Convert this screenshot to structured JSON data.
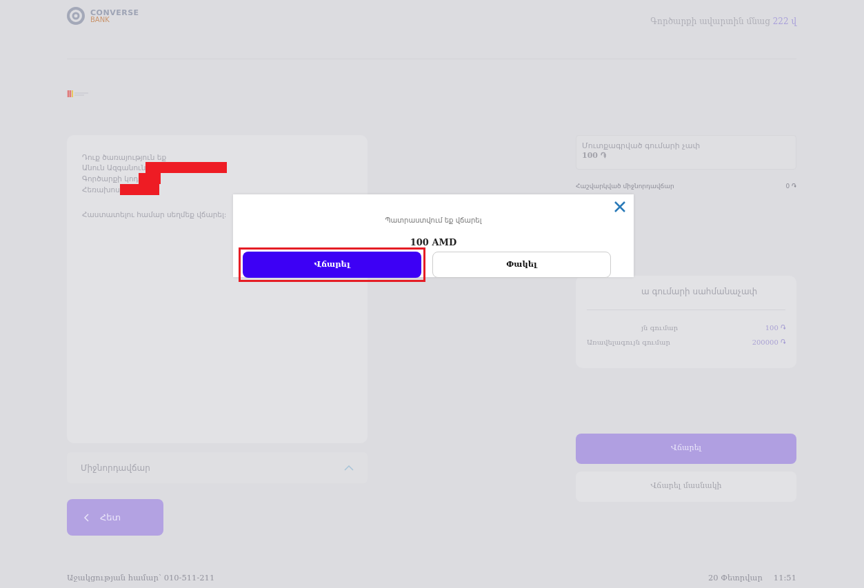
{
  "header": {
    "logo_top": "CONVERSE",
    "logo_bottom": "BANK",
    "timer_text": "Գործարքի ավարտին մնաց",
    "timer_value": "222 վ"
  },
  "details": {
    "intro": "Դուք ծառայություն եք",
    "fields": [
      {
        "label": "Անուն Ազգանուն"
      },
      {
        "label": "Գործարքի կոդ"
      },
      {
        "label": "Հեռախոս"
      }
    ],
    "confirm_text": "Հաստատելու համար սեղմեք վճարել:"
  },
  "fee_toggle": {
    "label": "Միջնորդավճար",
    "expanded": true
  },
  "back_button": "Հետ",
  "amount": {
    "label": "Մուտքագրված գումարի չափ",
    "value": "100 ֏"
  },
  "fee": {
    "label": "Հաշվարկված միջնորդավճար",
    "value": "0 ֏"
  },
  "limits": {
    "title": "ա գումարի սահմանաչափ",
    "rows": [
      {
        "label": "յն գումար",
        "value": "100 ֏"
      },
      {
        "label": "Առավելագույն գումար",
        "value": "200000 ֏"
      }
    ]
  },
  "actions": [
    {
      "label": "Վճարել",
      "kind": "primary"
    },
    {
      "label": "Վճարել մասնակի",
      "kind": "secondary"
    }
  ],
  "footer": {
    "support": "Աջակցության համար՝ 010-511-211",
    "date": "20 Փետրվար",
    "time": "11:51"
  },
  "modal": {
    "message": "Պատրաստվում եք վճարել",
    "amount": "100 AMD",
    "buttons": [
      {
        "label": "Վճարել",
        "kind": "primary",
        "highlighted": true
      },
      {
        "label": "Փակել",
        "kind": "secondary",
        "highlighted": false
      }
    ]
  }
}
